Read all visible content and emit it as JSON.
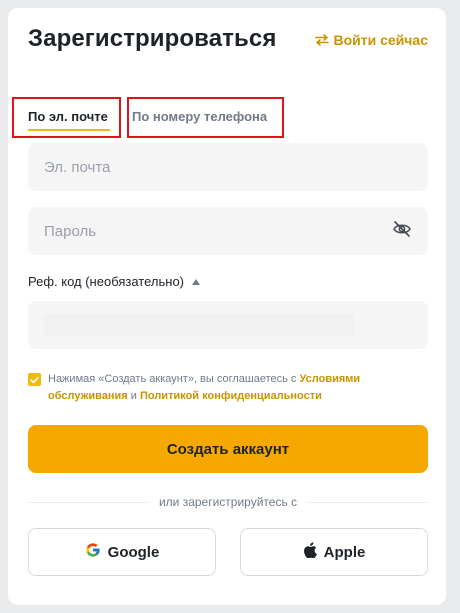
{
  "header": {
    "title": "Зарегистрироваться",
    "login_link": "Войти сейчас"
  },
  "tabs": [
    {
      "label": "По эл. почте",
      "active": true
    },
    {
      "label": "По номеру телефона",
      "active": false
    }
  ],
  "form": {
    "email_placeholder": "Эл. почта",
    "password_placeholder": "Пароль",
    "referral_label": "Реф. код (необязательно)",
    "referral_value": ""
  },
  "consent": {
    "checked": true,
    "text_before": "Нажимая «Создать аккаунт», вы соглашаетесь с ",
    "terms_link": "Условиями обслуживания",
    "text_middle": " и ",
    "privacy_link": "Политикой конфиденциальности"
  },
  "submit_label": "Создать аккаунт",
  "divider_text": "или зарегистрируйтесь с",
  "social": {
    "google_label": "Google",
    "apple_label": "Apple"
  },
  "colors": {
    "accent": "#F0B90B",
    "button": "#F5A800",
    "link": "#C99400",
    "highlight_box": "#E3111B"
  }
}
